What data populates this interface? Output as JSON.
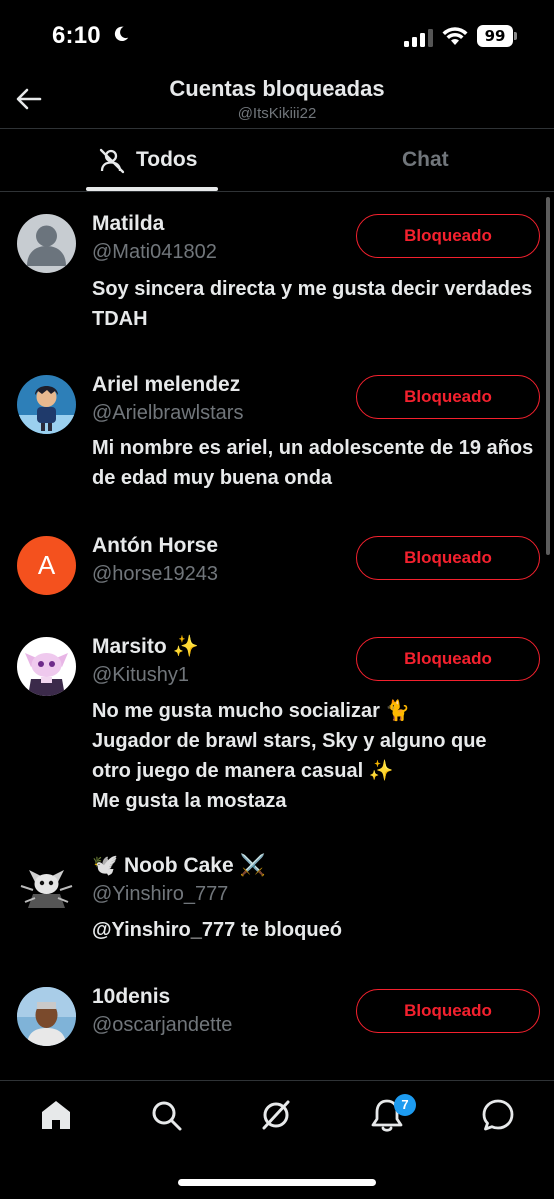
{
  "status_bar": {
    "time": "6:10",
    "battery": "99"
  },
  "header": {
    "title": "Cuentas bloqueadas",
    "subtitle": "@ItsKikiii22"
  },
  "tabs": [
    {
      "label": "Todos",
      "selected": true
    },
    {
      "label": "Chat",
      "selected": false
    }
  ],
  "accounts": [
    {
      "name": "Matilda",
      "handle": "@Mati041802",
      "bio": "Soy sincera directa y me gusta decir verdades TDAH",
      "button": "Bloqueado"
    },
    {
      "name": "Ariel melendez",
      "handle": "@Arielbrawlstars",
      "bio": "Mi nombre es ariel, un adolescente de 19 años de edad muy buena onda",
      "button": "Bloqueado"
    },
    {
      "name": "Antón Horse",
      "handle": "@horse19243",
      "bio": "",
      "button": "Bloqueado",
      "avatar_letter": "A",
      "avatar_color": "#f4511e"
    },
    {
      "name": "Marsito ✨",
      "handle": "@Kitushy1",
      "bio_lines": [
        "No me gusta mucho socializar 🐈",
        "Jugador de brawl stars, Sky y alguno que",
        "otro juego de manera casual ✨",
        "Me gusta la mostaza"
      ],
      "button": "Bloqueado"
    },
    {
      "name": "🕊️ Noob Cake ⚔️",
      "handle": "@Yinshiro_777",
      "bio": "@Yinshiro_777 te bloqueó"
    },
    {
      "name": "10denis",
      "handle": "@oscarjandette",
      "bio": "",
      "button": "Bloqueado"
    }
  ],
  "bottom_nav": {
    "items": [
      "home-icon",
      "search-icon",
      "grok-icon",
      "notifications-icon",
      "messages-icon"
    ],
    "notifications_badge": "7"
  },
  "colors": {
    "accent_red": "#f4212e",
    "accent_blue": "#1d9bf0",
    "muted": "#71767b"
  }
}
